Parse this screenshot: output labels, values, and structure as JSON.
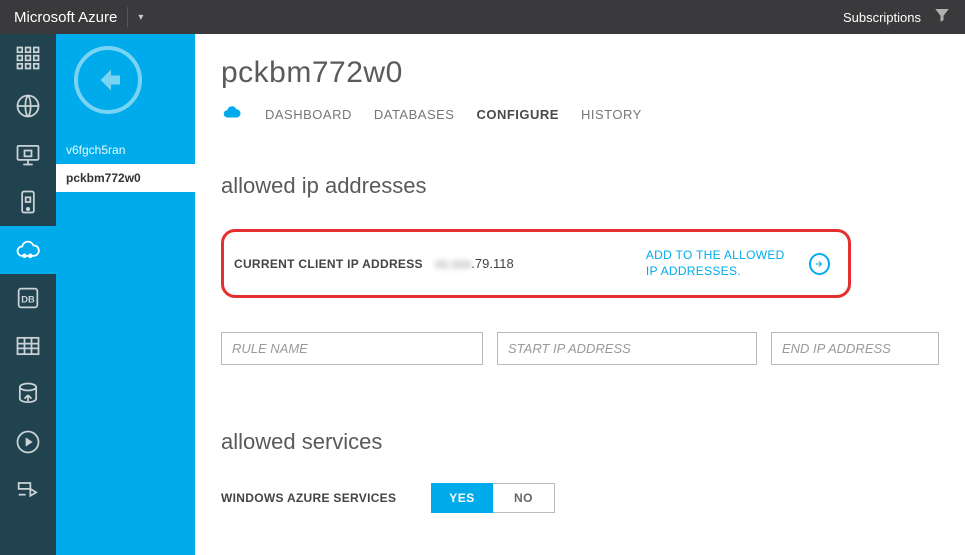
{
  "topbar": {
    "title": "Microsoft Azure",
    "subscriptions": "Subscriptions"
  },
  "side": {
    "items": [
      {
        "label": "v6fgch5ran",
        "active": false
      },
      {
        "label": "pckbm772w0",
        "active": true
      }
    ]
  },
  "page": {
    "title": "pckbm772w0",
    "tabs": [
      {
        "label": "DASHBOARD",
        "active": false
      },
      {
        "label": "DATABASES",
        "active": false
      },
      {
        "label": "CONFIGURE",
        "active": true
      },
      {
        "label": "HISTORY",
        "active": false
      }
    ]
  },
  "allowed_ip": {
    "heading": "allowed ip addresses",
    "current_label": "CURRENT CLIENT IP ADDRESS",
    "current_blur_prefix": "xx.xxx",
    "current_visible_suffix": ".79.118",
    "add_link": "ADD TO THE ALLOWED IP ADDRESSES.",
    "inputs": {
      "rule_placeholder": "RULE NAME",
      "start_placeholder": "START IP ADDRESS",
      "end_placeholder": "END IP ADDRESS"
    }
  },
  "allowed_services": {
    "heading": "allowed services",
    "label": "WINDOWS AZURE SERVICES",
    "yes": "YES",
    "no": "NO",
    "value": "YES"
  }
}
